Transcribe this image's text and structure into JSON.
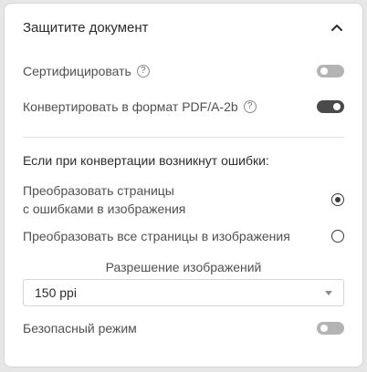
{
  "panel": {
    "title": "Защитите документ",
    "collapse_icon": "chevron-up-icon"
  },
  "options": {
    "certify": {
      "label": "Сертифицировать",
      "enabled": false,
      "help_icon": "help-icon",
      "help_glyph": "?"
    },
    "convert_pdfa": {
      "label": "Конвертировать в формат PDF/A-2b",
      "enabled": true,
      "help_icon": "help-icon",
      "help_glyph": "?"
    }
  },
  "errors_section": {
    "heading": "Если при конвертации возникнут ошибки:",
    "choices": [
      {
        "line1": "Преобразовать страницы",
        "line2": "с ошибками в изображения",
        "selected": true
      },
      {
        "line1": "Преобразовать все страницы в изображения",
        "line2": "",
        "selected": false
      }
    ]
  },
  "resolution": {
    "label": "Разрешение изображений",
    "value": "150 ppi",
    "dropdown_icon": "caret-down-icon"
  },
  "safe_mode": {
    "label": "Безопасный режим",
    "enabled": false
  }
}
